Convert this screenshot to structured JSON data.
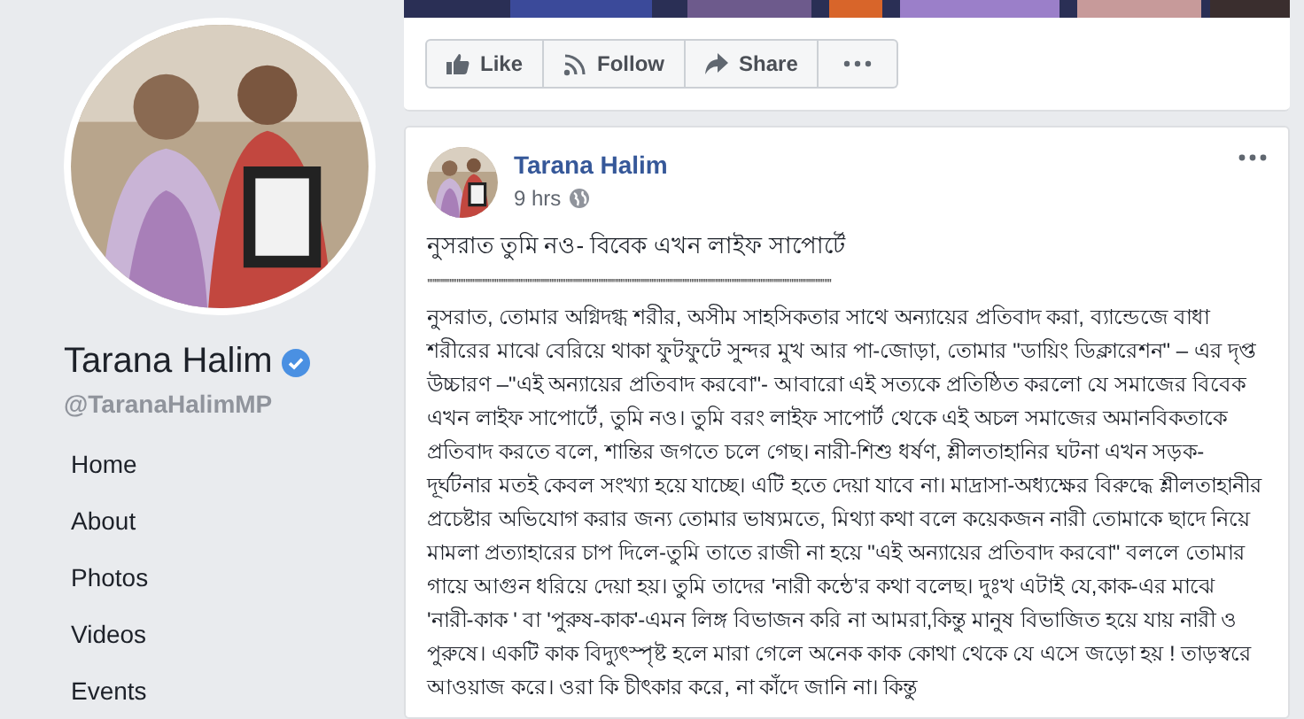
{
  "profile": {
    "name": "Tarana Halim",
    "verified": true,
    "handle": "@TaranaHalimMP"
  },
  "nav": [
    {
      "label": "Home"
    },
    {
      "label": "About"
    },
    {
      "label": "Photos"
    },
    {
      "label": "Videos"
    },
    {
      "label": "Events"
    }
  ],
  "actions": [
    {
      "kind": "like",
      "label": "Like"
    },
    {
      "kind": "follow",
      "label": "Follow"
    },
    {
      "kind": "share",
      "label": "Share"
    },
    {
      "kind": "more"
    }
  ],
  "post": {
    "author": "Tarana Halim",
    "time": "9 hrs",
    "title": "নুসরাত তুমি নও- বিবেক এখন লাইফ সাপোর্টে",
    "separator": "''''''''''''''''''''''''''''''''''''''''''''''''''''''''''''''''''''''''''''''''''''''''''''''''''''''''''''''''''''''''''''''''''''''''''''''''''''''''''''''''''''''''''''''''''''''''''''''''''''''''''''''''''''''''''''''",
    "body": "নুসরাত, তোমার অগ্নিদগ্ধ শরীর, অসীম সাহসিকতার সাথে অন্যায়ের প্রতিবাদ করা, ব্যান্ডেজে বাধা শরীরের মাঝে বেরিয়ে থাকা ফুটফুটে সুন্দর মুখ আর পা-জোড়া, তোমার \"ডায়িং ডিক্লারেশন\" – এর দৃপ্ত উচ্চারণ –\"এই অন্যায়ের প্রতিবাদ করবো\"- আবারো এই সত্যকে প্রতিষ্ঠিত করলো যে সমাজের বিবেক এখন লাইফ সাপোর্টে, তুমি নও। তুমি বরং লাইফ সাপোর্ট থেকে এই অচল সমাজের অমানবিকতাকে প্রতিবাদ করতে বলে, শান্তির জগতে চলে গেছ। নারী-শিশু ধর্ষণ, শ্লীলতাহানির ঘটনা এখন সড়ক-দূর্ঘটনার মতই কেবল সংখ্যা হয়ে যাচ্ছে। এটি হতে দেয়া যাবে না। মাদ্রাসা-অধ্যক্ষের বিরুদ্ধে শ্লীলতাহানীর প্রচেষ্টার অভিযোগ করার জন্য তোমার ভাষ্যমতে, মিথ্যা কথা বলে কয়েকজন নারী তোমাকে ছাদে নিয়ে মামলা প্রত্যাহারের চাপ দিলে-তুমি তাতে রাজী না হয়ে \"এই অন্যায়ের প্রতিবাদ করবো\" বললে তোমার গায়ে আগুন ধরিয়ে দেয়া হয়। তুমি তাদের 'নারী কন্ঠে'র কথা বলেছ। দুঃখ এটাই যে,কাক-এর মাঝে 'নারী-কাক ' বা 'পুরুষ-কাক'-এমন লিঙ্গ বিভাজন করি না আমরা,কিন্তু মানুষ বিভাজিত হয়ে যায় নারী ও পুরুষে। একটি কাক বিদ্যুৎস্পৃষ্ট হলে মারা গেলে অনেক কাক কোথা থেকে যে এসে জড়ো হয় ! তাড়স্বরে আওয়াজ করে। ওরা কি চীৎকার করে, না কাঁদে জানি না। কিন্তু"
  }
}
